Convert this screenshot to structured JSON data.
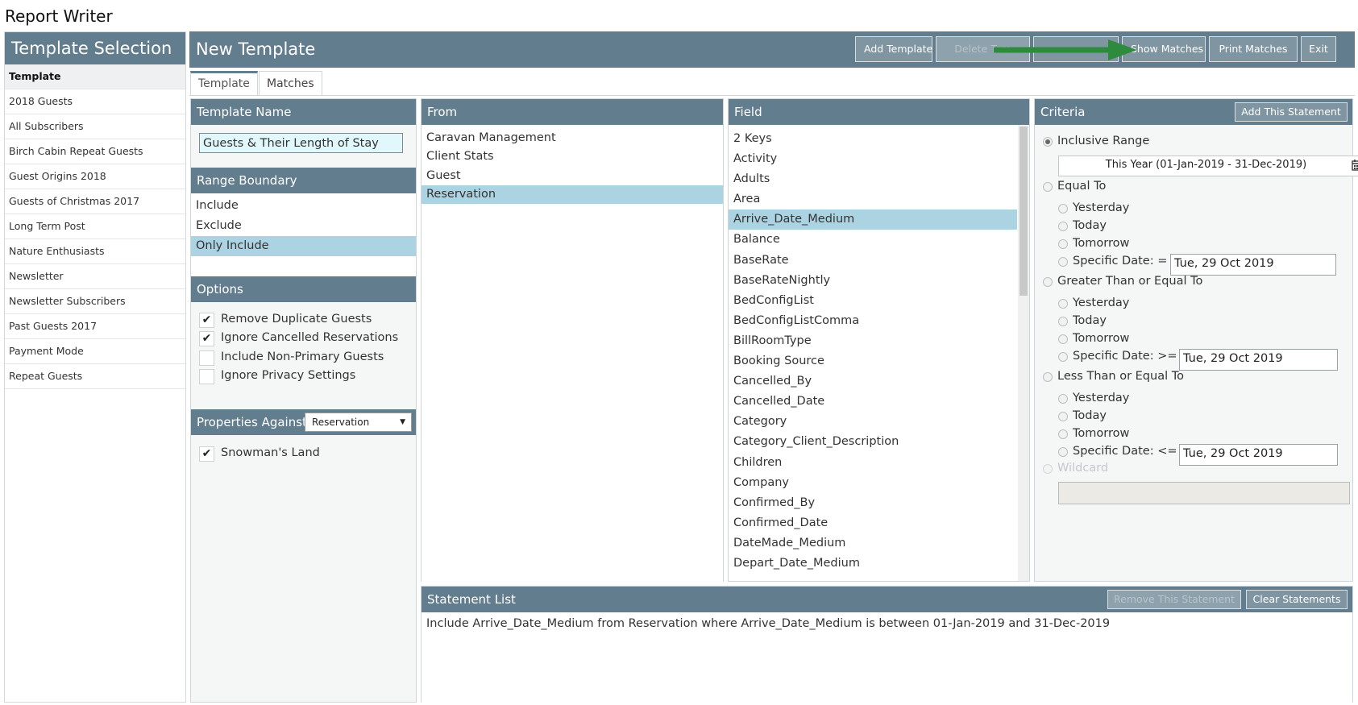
{
  "app_title": "Report Writer",
  "sidebar": {
    "title": "Template Selection",
    "items": [
      {
        "label": "Template",
        "header": true
      },
      {
        "label": "2018 Guests"
      },
      {
        "label": "All Subscribers"
      },
      {
        "label": "Birch Cabin Repeat Guests"
      },
      {
        "label": "Guest Origins 2018"
      },
      {
        "label": "Guests of Christmas 2017"
      },
      {
        "label": "Long Term Post"
      },
      {
        "label": "Nature Enthusiasts"
      },
      {
        "label": "Newsletter"
      },
      {
        "label": "Newsletter Subscribers"
      },
      {
        "label": "Past Guests 2017"
      },
      {
        "label": "Payment Mode"
      },
      {
        "label": "Repeat Guests"
      }
    ]
  },
  "header": {
    "title": "New Template",
    "buttons": {
      "add_template": "Add Template",
      "delete_template": "Delete Tem",
      "hidden_button": "",
      "show_matches": "Show Matches",
      "print_matches": "Print Matches",
      "exit": "Exit"
    }
  },
  "tabs": {
    "template": "Template",
    "matches": "Matches"
  },
  "template_name": {
    "heading": "Template Name",
    "value": "Guests & Their Length of Stay"
  },
  "range_boundary": {
    "heading": "Range Boundary",
    "items": [
      "Include",
      "Exclude",
      "Only Include"
    ],
    "selected": "Only Include"
  },
  "options": {
    "heading": "Options",
    "items": [
      {
        "label": "Remove Duplicate Guests",
        "checked": true
      },
      {
        "label": "Ignore Cancelled Reservations",
        "checked": true
      },
      {
        "label": "Include Non-Primary Guests",
        "checked": false
      },
      {
        "label": "Ignore Privacy Settings",
        "checked": false
      }
    ]
  },
  "properties_against": {
    "heading": "Properties Against",
    "select_value": "Reservation",
    "items": [
      {
        "label": "Snowman's Land",
        "checked": true
      }
    ]
  },
  "from": {
    "heading": "From",
    "items": [
      "Caravan Management",
      "Client Stats",
      "Guest",
      "Reservation"
    ],
    "selected": "Reservation"
  },
  "field": {
    "heading": "Field",
    "items": [
      "2 Keys",
      "Activity",
      "Adults",
      "Area",
      "Arrive_Date_Medium",
      "Balance",
      "BaseRate",
      "BaseRateNightly",
      "BedConfigList",
      "BedConfigListComma",
      "BillRoomType",
      "Booking Source",
      "Cancelled_By",
      "Cancelled_Date",
      "Category",
      "Category_Client_Description",
      "Children",
      "Company",
      "Confirmed_By",
      "Confirmed_Date",
      "DateMade_Medium",
      "Depart_Date_Medium"
    ],
    "selected": "Arrive_Date_Medium"
  },
  "criteria": {
    "heading": "Criteria",
    "add_button": "Add This Statement",
    "inclusive_range": "Inclusive Range",
    "range_value": "This Year (01-Jan-2019 - 31-Dec-2019)",
    "equal_to": "Equal To",
    "greater_equal": "Greater Than or Equal To",
    "less_equal": "Less Than or Equal To",
    "yesterday": "Yesterday",
    "today": "Today",
    "tomorrow": "Tomorrow",
    "specific_eq": "Specific Date: =",
    "specific_ge": "Specific Date: >=",
    "specific_le": "Specific Date: <=",
    "date_value": "Tue, 29 Oct 2019",
    "wildcard": "Wildcard"
  },
  "statement_list": {
    "heading": "Statement List",
    "remove_button": "Remove This Statement",
    "clear_button": "Clear Statements",
    "statements": [
      "Include Arrive_Date_Medium from Reservation where Arrive_Date_Medium is between 01-Jan-2019 and 31-Dec-2019"
    ]
  },
  "colors": {
    "header": "#627d8d",
    "selection": "#acd3e1",
    "annotation_arrow": "#2e8b3e"
  }
}
